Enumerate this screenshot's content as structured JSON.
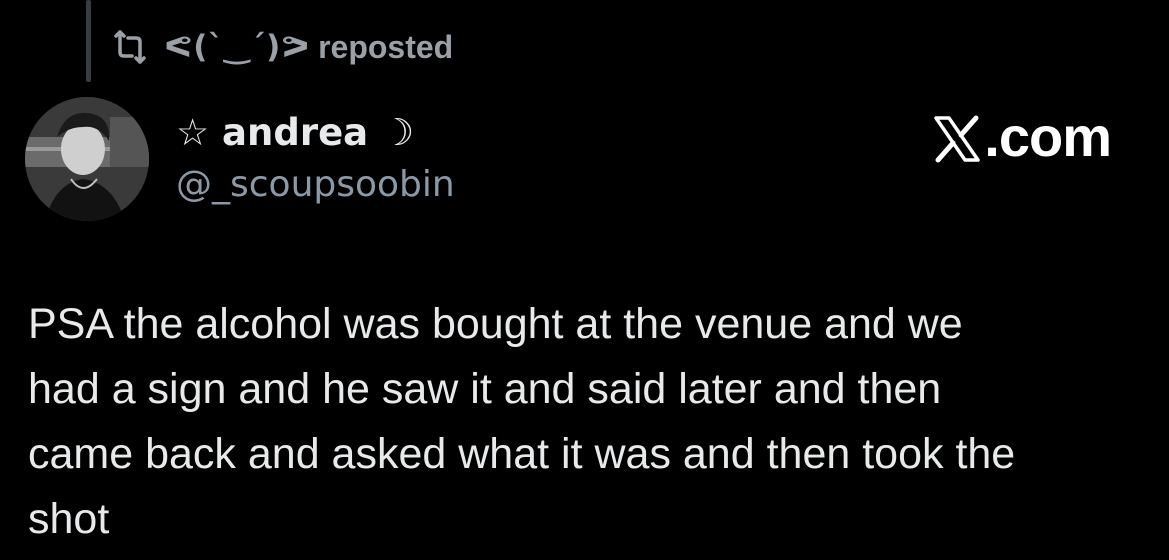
{
  "repost": {
    "icon": "repost-icon",
    "reposter_name": "ᕙ(`‿´)ᕗ",
    "label": "reposted"
  },
  "author": {
    "avatar_icon": "avatar",
    "display_name": "☆ andrea ☽",
    "handle": "@_scoupsoobin"
  },
  "brand": {
    "logo_icon": "x-logo-icon",
    "text": ".com"
  },
  "tweet": {
    "text": "PSA the alcohol was bought at the venue and we\nhad a sign and he saw it and said later and then\ncame back and asked what it was and then took the\nshot"
  },
  "colors": {
    "background": "#000000",
    "primary_text": "#e7e9ea",
    "secondary_text": "#8b98a5"
  }
}
